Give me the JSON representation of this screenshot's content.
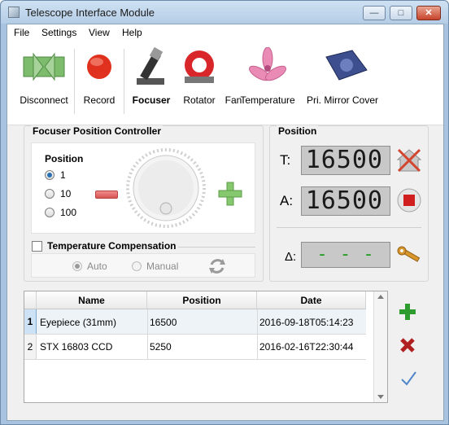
{
  "window": {
    "title": "Telescope Interface Module",
    "controls": {
      "minimize": "—",
      "maximize": "□",
      "close": "✕"
    }
  },
  "menu": [
    "File",
    "Settings",
    "View",
    "Help"
  ],
  "toolbar": {
    "items": [
      {
        "label": "Disconnect",
        "icon": "disconnect-icon"
      },
      {
        "label": "Record",
        "icon": "record-icon"
      },
      {
        "label": "Focuser",
        "icon": "focuser-icon",
        "active": true
      },
      {
        "label": "Rotator",
        "icon": "rotator-icon"
      },
      {
        "label": "Fan",
        "icon": "fan-icon"
      },
      {
        "label": "Temperature",
        "icon": "temperature-icon"
      },
      {
        "label": "Pri. Mirror Cover",
        "icon": "mirror-cover-icon"
      }
    ]
  },
  "focuser": {
    "title": "Focuser Position Controller",
    "step_label": "Position",
    "steps": [
      "1",
      "10",
      "100"
    ],
    "selected_step": "1",
    "temp_comp": {
      "label": "Temperature Compensation",
      "checked": false,
      "modes": [
        "Auto",
        "Manual"
      ],
      "selected_mode": "Auto"
    }
  },
  "position": {
    "title": "Position",
    "target_label": "T:",
    "target_value": "16500",
    "actual_label": "A:",
    "actual_value": "16500",
    "delta_label": "Δ:",
    "delta_value": "- - -"
  },
  "table": {
    "columns": [
      "Name",
      "Position",
      "Date"
    ],
    "rows": [
      {
        "index": "1",
        "name": "Eyepiece (31mm)",
        "position": "16500",
        "date": "2016-09-18T05:14:23"
      },
      {
        "index": "2",
        "name": "STX 16803 CCD",
        "position": "5250",
        "date": "2016-02-16T22:30:44"
      }
    ]
  },
  "colors": {
    "accent": "#2a6fb1",
    "add_green": "#2e9b2e",
    "delete_red": "#b02020",
    "lcd_bg": "#c8c8c8",
    "delta_green": "#1f9a1f"
  }
}
